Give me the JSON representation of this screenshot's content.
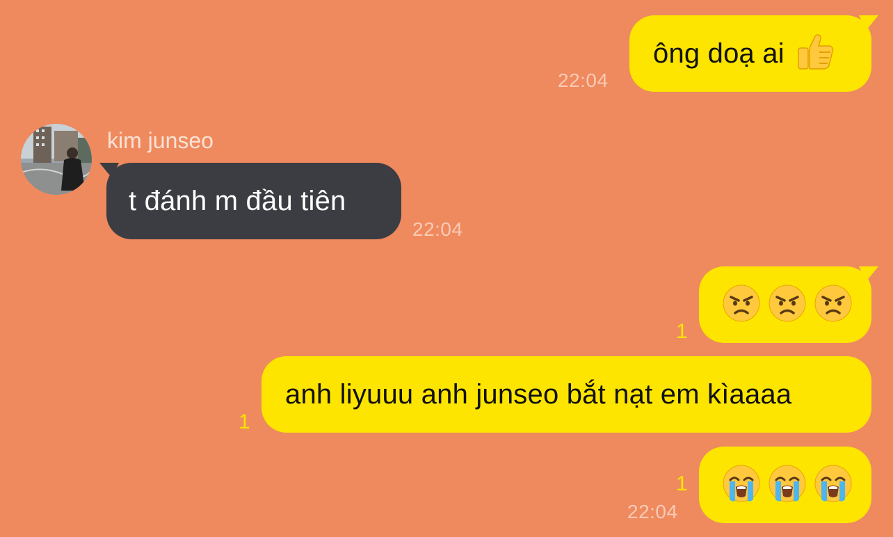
{
  "contact": {
    "name": "kim junseo",
    "avatar_icon": "avatar-photo"
  },
  "colors": {
    "background": "#EF8A5E",
    "sent_bubble": "#FEE500",
    "received_bubble": "#3C3D42",
    "unread_count": "#FEE500"
  },
  "messages": [
    {
      "direction": "sent",
      "text": "ông doạ ai",
      "emoji": "thumbs-up",
      "time": "22:04"
    },
    {
      "direction": "received",
      "text": "t đánh m đầu tiên",
      "time": "22:04"
    },
    {
      "direction": "sent",
      "emoji": [
        "angry-face",
        "angry-face",
        "angry-face"
      ],
      "unread": "1"
    },
    {
      "direction": "sent",
      "text": "anh liyuuu anh junseo bắt nạt em kìaaaa",
      "unread": "1"
    },
    {
      "direction": "sent",
      "emoji": [
        "loudly-crying-face",
        "loudly-crying-face",
        "loudly-crying-face"
      ],
      "unread": "1",
      "time": "22:04"
    }
  ]
}
